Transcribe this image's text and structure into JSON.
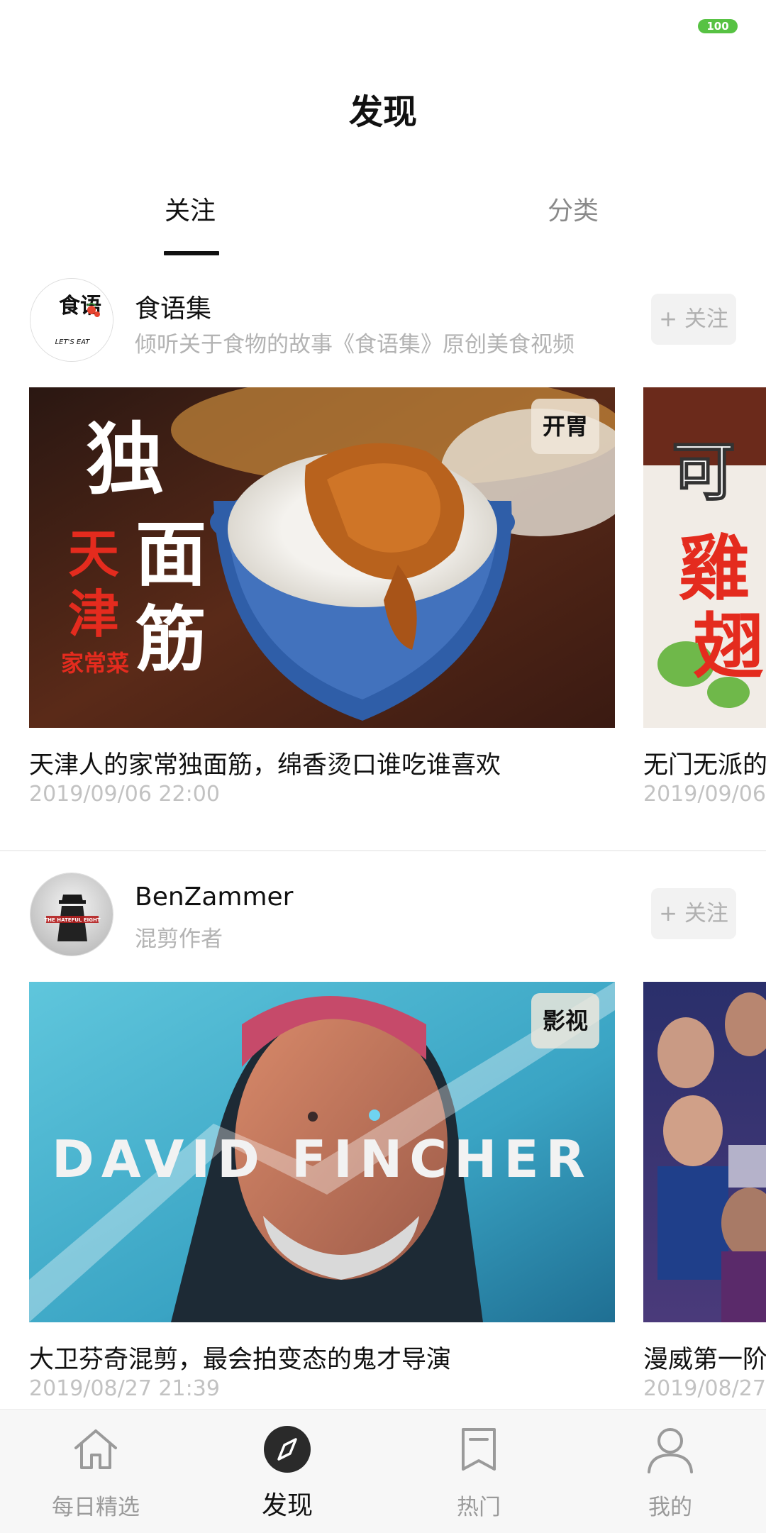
{
  "status_bar": {
    "battery": "100"
  },
  "header": {
    "title": "发现"
  },
  "tabs": [
    {
      "label": "关注",
      "active": true
    },
    {
      "label": "分类",
      "active": false
    }
  ],
  "sections": [
    {
      "channel": {
        "name": "食语集",
        "description": "倾听关于食物的故事《食语集》原创美食视频",
        "follow_label": "+ 关注",
        "avatar_text": "食语",
        "avatar_subtext": "LET'S EAT"
      },
      "cards": [
        {
          "tag": "开胃",
          "title": "天津人的家常独面筋，绵香烫口谁吃谁喜欢",
          "date": "2019/09/06 22:00",
          "art_text": [
            "独",
            "面",
            "筋",
            "天",
            "津",
            "家常菜"
          ]
        },
        {
          "title": "无门无派的",
          "date": "2019/09/06",
          "art_text": [
            "可",
            "雞",
            "翅"
          ]
        }
      ]
    },
    {
      "channel": {
        "name": "BenZammer",
        "description": "混剪作者",
        "follow_label": "+ 关注",
        "avatar_text": "THE HATEFUL EIGHT"
      },
      "cards": [
        {
          "tag": "影视",
          "title": "大卫芬奇混剪，最会拍变态的鬼才导演",
          "date": "2019/08/27 21:39",
          "art_text": [
            "DAVID FINCHER"
          ]
        },
        {
          "title": "漫威第一阶",
          "date": "2019/08/27"
        }
      ]
    }
  ],
  "bottom_nav": [
    {
      "label": "每日精选",
      "icon": "home-icon",
      "active": false
    },
    {
      "label": "发现",
      "icon": "compass-icon",
      "active": true
    },
    {
      "label": "热门",
      "icon": "bookmark-icon",
      "active": false
    },
    {
      "label": "我的",
      "icon": "user-icon",
      "active": false
    }
  ],
  "colors": {
    "accent": "#111111",
    "secondary_text": "#b3b3b3",
    "date_text": "#c2c2c2",
    "battery": "#57c243",
    "nav_background": "#f7f7f7"
  }
}
